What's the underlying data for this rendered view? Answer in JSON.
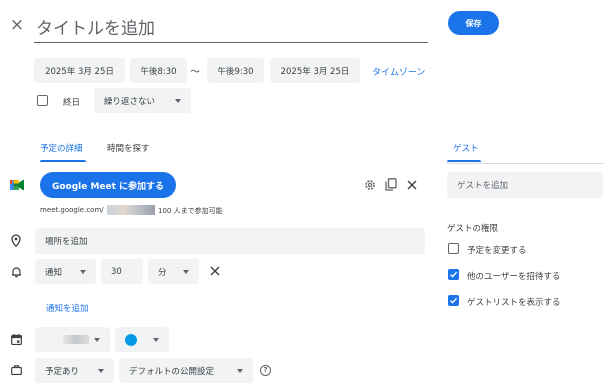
{
  "header": {
    "close_label": "×",
    "title_placeholder": "タイトルを追加",
    "save_label": "保存"
  },
  "datetime": {
    "start_date": "2025年 3月 25日",
    "start_time": "午後8:30",
    "separator": "〜",
    "end_time": "午後9:30",
    "end_date": "2025年 3月 25日",
    "timezone_label": "タイムゾーン",
    "allday_label": "終日",
    "repeat_label": "繰り返さない"
  },
  "tabs": {
    "details": "予定の詳細",
    "find_time": "時間を探す",
    "guests": "ゲスト"
  },
  "meet": {
    "join_label": "Google Meet に参加する",
    "link_prefix": "meet.google.com/",
    "capacity": "100 人まで参加可能"
  },
  "location": {
    "placeholder": "場所を追加"
  },
  "notification": {
    "type": "通知",
    "amount": "30",
    "unit": "分",
    "add_label": "通知を追加"
  },
  "calendar": {
    "event_color": "#039be5"
  },
  "availability": {
    "busy_label": "予定あり",
    "visibility_label": "デフォルトの公開設定",
    "help_label": "?"
  },
  "guests": {
    "add_placeholder": "ゲストを追加",
    "permissions_title": "ゲストの権限",
    "permissions": [
      {
        "label": "予定を変更する",
        "checked": false
      },
      {
        "label": "他のユーザーを招待する",
        "checked": true
      },
      {
        "label": "ゲストリストを表示する",
        "checked": true
      }
    ]
  },
  "colors": {
    "accent": "#1a73e8",
    "chip_bg": "#f1f3f4",
    "text": "#3c4043"
  }
}
